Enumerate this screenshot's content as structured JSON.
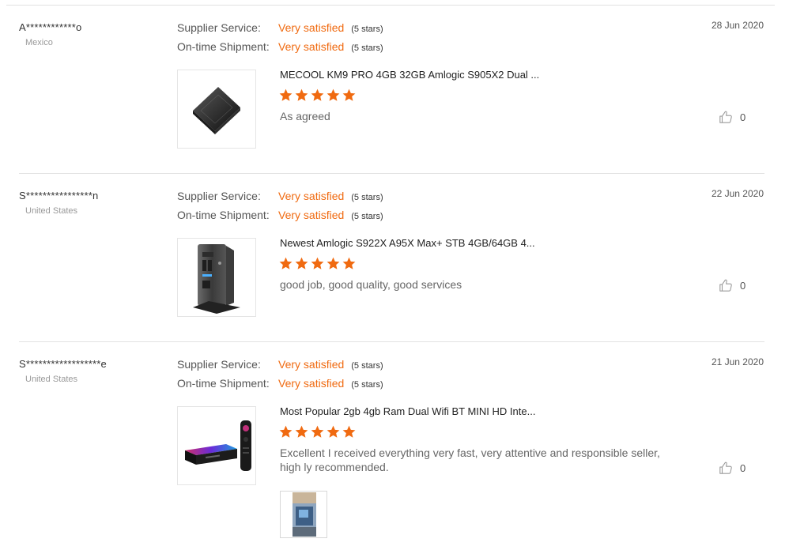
{
  "colors": {
    "accent": "#f06a10",
    "separator": "#e2e2e2",
    "muted_text": "#999999"
  },
  "reviews": [
    {
      "buyer": "A************o",
      "country": "Mexico",
      "date": "28 Jun 2020",
      "supplier_service_label": "Supplier Service:",
      "supplier_service_value": "Very satisfied",
      "supplier_service_stars": "(5 stars)",
      "shipment_label": "On-time Shipment:",
      "shipment_value": "Very satisfied",
      "shipment_stars": "(5 stars)",
      "product_title": "MECOOL KM9 PRO 4GB 32GB Amlogic S905X2 Dual ...",
      "product_image_icon": "tv-box-square-icon",
      "rating": 5,
      "feedback": "As agreed",
      "helpful_count": "0"
    },
    {
      "buyer": "S****************n",
      "country": "United States",
      "date": "22 Jun 2020",
      "supplier_service_label": "Supplier Service:",
      "supplier_service_value": "Very satisfied",
      "supplier_service_stars": "(5 stars)",
      "shipment_label": "On-time Shipment:",
      "shipment_value": "Very satisfied",
      "shipment_stars": "(5 stars)",
      "product_title": "Newest Amlogic S922X A95X Max+ STB 4GB/64GB 4...",
      "product_image_icon": "tv-box-tower-icon",
      "rating": 5,
      "feedback": "good job, good quality, good services",
      "helpful_count": "0"
    },
    {
      "buyer": "S******************e",
      "country": "United States",
      "date": "21 Jun 2020",
      "supplier_service_label": "Supplier Service:",
      "supplier_service_value": "Very satisfied",
      "supplier_service_stars": "(5 stars)",
      "shipment_label": "On-time Shipment:",
      "shipment_value": "Very satisfied",
      "shipment_stars": "(5 stars)",
      "product_title": "Most Popular 2gb 4gb Ram Dual Wifi BT MINI HD Inte...",
      "product_image_icon": "tv-box-remote-icon",
      "rating": 5,
      "feedback": "Excellent I received everything very fast, very attentive and responsible seller, high ly recommended.",
      "helpful_count": "0",
      "photo_icon": "customer-photo-icon"
    }
  ]
}
